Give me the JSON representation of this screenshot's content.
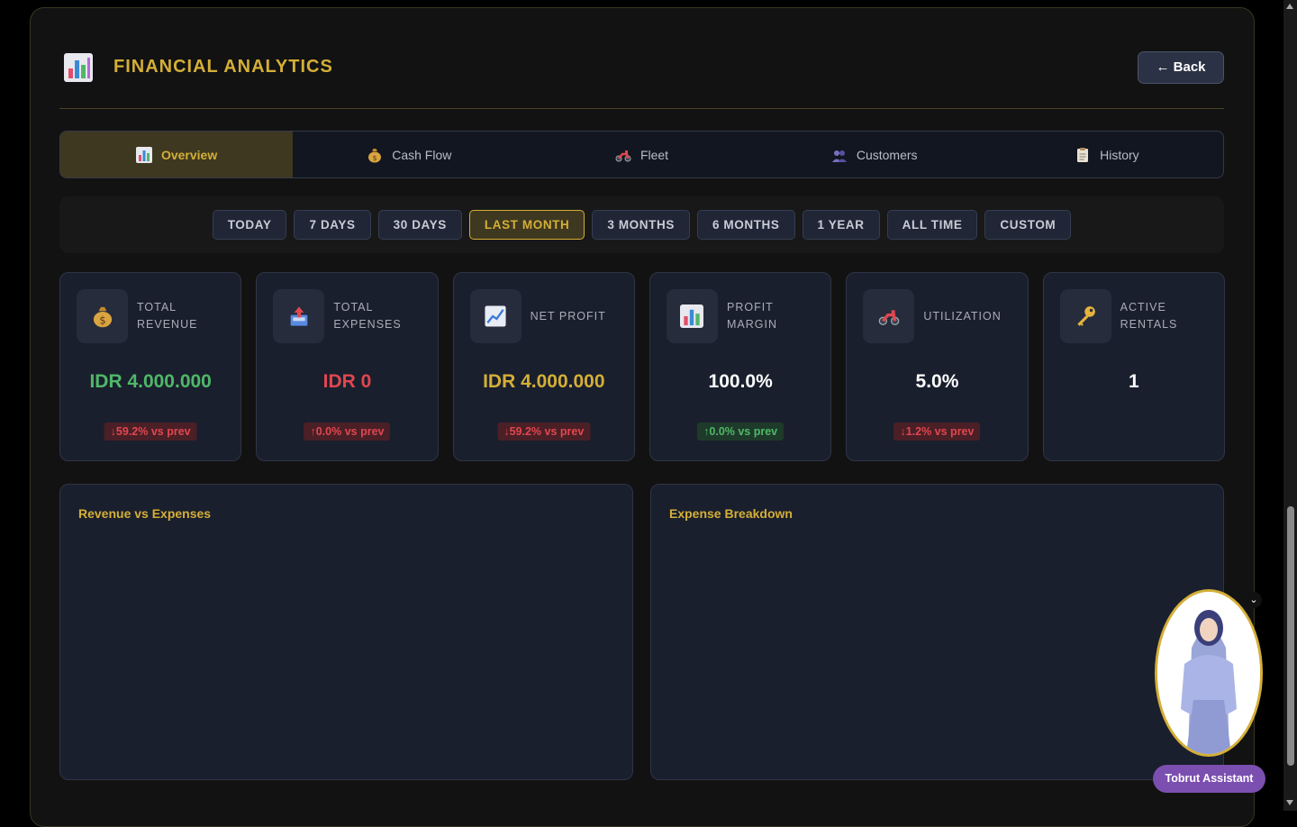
{
  "header": {
    "title": "FINANCIAL ANALYTICS",
    "back_label": "← Back"
  },
  "tabs": [
    {
      "label": "Overview",
      "icon": "bar-chart-icon",
      "active": true
    },
    {
      "label": "Cash Flow",
      "icon": "money-bag-icon",
      "active": false
    },
    {
      "label": "Fleet",
      "icon": "scooter-icon",
      "active": false
    },
    {
      "label": "Customers",
      "icon": "people-icon",
      "active": false
    },
    {
      "label": "History",
      "icon": "clipboard-icon",
      "active": false
    }
  ],
  "filters": [
    {
      "label": "TODAY",
      "active": false
    },
    {
      "label": "7 DAYS",
      "active": false
    },
    {
      "label": "30 DAYS",
      "active": false
    },
    {
      "label": "LAST MONTH",
      "active": true
    },
    {
      "label": "3 MONTHS",
      "active": false
    },
    {
      "label": "6 MONTHS",
      "active": false
    },
    {
      "label": "1 YEAR",
      "active": false
    },
    {
      "label": "ALL TIME",
      "active": false
    },
    {
      "label": "CUSTOM",
      "active": false
    }
  ],
  "cards": [
    {
      "label": "TOTAL REVENUE",
      "icon": "money-bag-icon",
      "value": "IDR 4.000.000",
      "value_color": "#4fb868",
      "delta": "↓59.2% vs prev",
      "delta_dir": "down"
    },
    {
      "label": "TOTAL EXPENSES",
      "icon": "outbox-icon",
      "value": "IDR 0",
      "value_color": "#e0474f",
      "delta": "↑0.0% vs prev",
      "delta_dir": "down"
    },
    {
      "label": "NET PROFIT",
      "icon": "trend-up-icon",
      "value": "IDR 4.000.000",
      "value_color": "#d4af37",
      "delta": "↓59.2% vs prev",
      "delta_dir": "down"
    },
    {
      "label": "PROFIT MARGIN",
      "icon": "bar-chart-icon",
      "value": "100.0%",
      "value_color": "#ffffff",
      "delta": "↑0.0% vs prev",
      "delta_dir": "up"
    },
    {
      "label": "UTILIZATION",
      "icon": "scooter-icon",
      "value": "5.0%",
      "value_color": "#ffffff",
      "delta": "↓1.2% vs prev",
      "delta_dir": "down"
    },
    {
      "label": "ACTIVE RENTALS",
      "icon": "key-icon",
      "value": "1",
      "value_color": "#ffffff",
      "delta": "",
      "delta_dir": ""
    }
  ],
  "charts": {
    "revenue_title": "Revenue vs Expenses",
    "expense_title": "Expense Breakdown"
  },
  "assistant": {
    "label": "Tobrut Assistant"
  },
  "colors": {
    "accent": "#d4af37",
    "positive": "#4fb868",
    "negative": "#e0474f",
    "assistant": "#7b4fb0"
  }
}
